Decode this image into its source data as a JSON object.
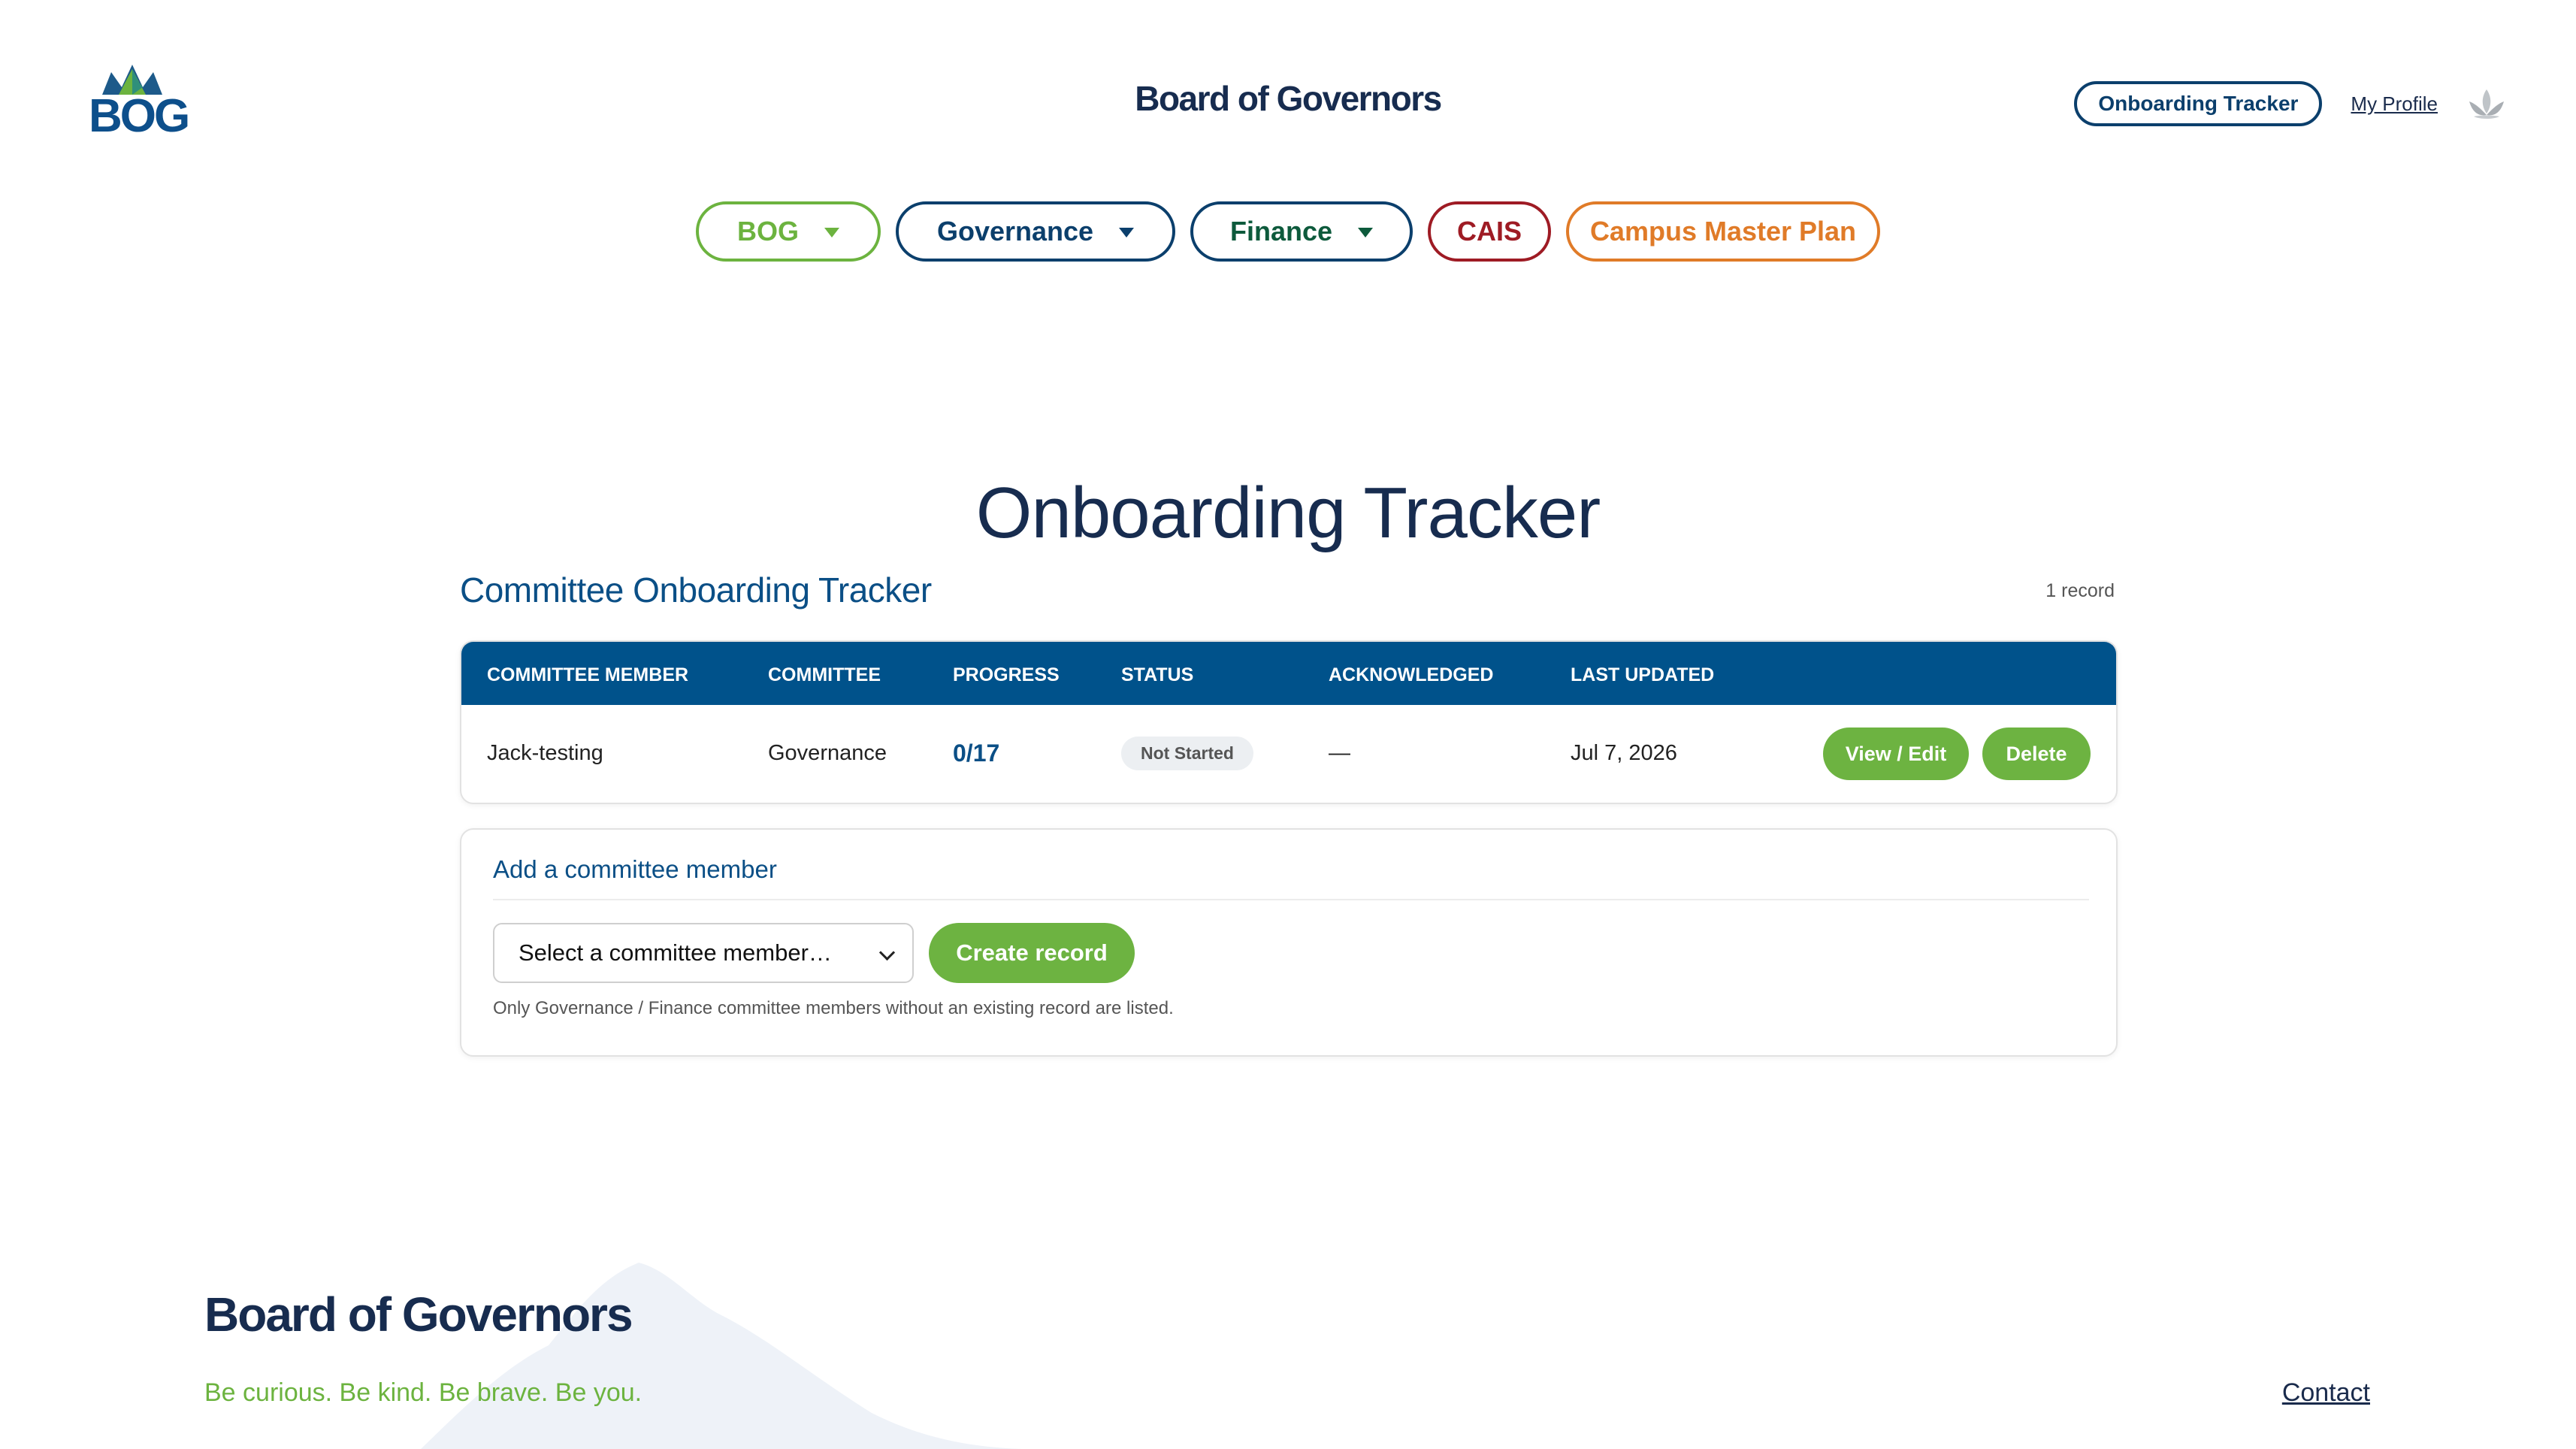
{
  "brand": {
    "logo_text": "BOG",
    "site_title": "Board of Governors",
    "colors": {
      "navy": "#172c4f",
      "blue": "#00528b",
      "green": "#6cb33f",
      "red": "#9e1b24",
      "orange": "#e07b28"
    }
  },
  "header": {
    "tracker_link": "Onboarding Tracker",
    "profile_link": "My Profile",
    "profile_icon": "lotus-icon"
  },
  "nav": {
    "items": [
      {
        "label": "BOG",
        "has_dropdown": true
      },
      {
        "label": "Governance",
        "has_dropdown": true
      },
      {
        "label": "Finance",
        "has_dropdown": true
      },
      {
        "label": "CAIS",
        "has_dropdown": false
      },
      {
        "label": "Campus Master Plan",
        "has_dropdown": false
      }
    ]
  },
  "main": {
    "page_title": "Onboarding Tracker",
    "section_title": "Committee Onboarding Tracker",
    "record_count": "1 record",
    "table": {
      "columns": [
        "COMMITTEE MEMBER",
        "COMMITTEE",
        "PROGRESS",
        "STATUS",
        "ACKNOWLEDGED",
        "LAST UPDATED"
      ],
      "rows": [
        {
          "member": "Jack-testing",
          "committee": "Governance",
          "progress": "0/17",
          "status": "Not Started",
          "acknowledged": "—",
          "last_updated": "Jul 7, 2026",
          "view_label": "View / Edit",
          "delete_label": "Delete"
        }
      ]
    },
    "add_member": {
      "title": "Add a committee member",
      "select_value": "Select a committee member…",
      "create_label": "Create record",
      "hint": "Only Governance / Finance committee members without an existing record are listed."
    }
  },
  "footer": {
    "title": "Board of Governors",
    "tagline": "Be curious. Be kind. Be brave. Be you.",
    "contact": "Contact"
  }
}
